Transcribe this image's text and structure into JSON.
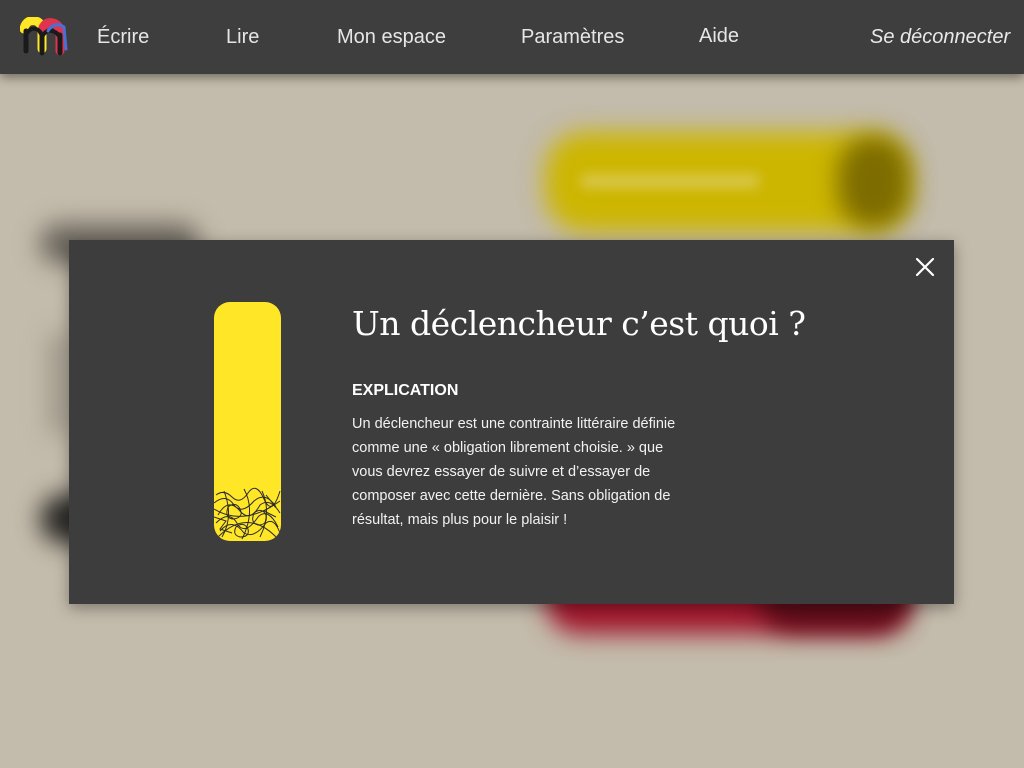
{
  "nav": {
    "logo_icon": "m-logo-icon",
    "items": [
      {
        "label": "Écrire"
      },
      {
        "label": "Lire"
      },
      {
        "label": "Mon espace"
      },
      {
        "label": "Paramètres"
      },
      {
        "label": "Aide"
      }
    ],
    "logout": "Se déconnecter"
  },
  "modal": {
    "close_icon": "close-icon",
    "illustration": "trigger-pill-icon",
    "title": "Un déclencheur c’est quoi ?",
    "subtitle": "EXPLICATION",
    "body": "Un déclencheur est une contrainte littéraire définie comme une « obligation librement choisie. » que vous devrez essayer de suivre  et d’essayer de composer avec cette dernière. Sans obligation de résultat, mais plus pour le plaisir !"
  },
  "colors": {
    "navbar": "#3e3e3e",
    "page_background": "#c3bbab",
    "modal_background": "#3d3d3d",
    "accent_yellow": "#ffe627",
    "accent_red": "#a0172c"
  }
}
